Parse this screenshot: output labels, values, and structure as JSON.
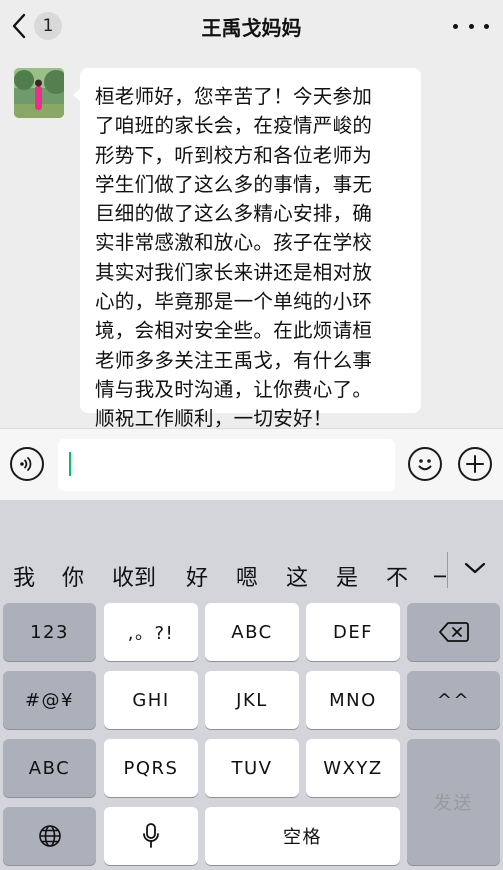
{
  "header": {
    "back_badge": "1",
    "title": "王禹戈妈妈"
  },
  "chat": {
    "message_lines": [
      "桓老师好，您辛苦了！今天参加",
      "了咱班的家长会，在疫情严峻的",
      "形势下，听到校方和各位老师为",
      "学生们做了这么多的事情，事无",
      "巨细的做了这么多精心安排，确",
      "实非常感激和放心。孩子在学校",
      "其实对我们家长来讲还是相对放",
      "心的，毕竟那是一个单纯的小环",
      "境，会相对安全些。在此烦请桓",
      "老师多多关注王禹戈，有什么事",
      "情与我及时沟通，让你费心了。",
      "顺祝工作顺利，一切安好！"
    ]
  },
  "input": {
    "value": ""
  },
  "keyboard": {
    "suggestions": [
      "我",
      "你",
      "收到",
      "好",
      "嗯",
      "这",
      "是",
      "不",
      "一"
    ],
    "keys": {
      "num": "123",
      "punct": ",。?!",
      "abc": "ABC",
      "def": "DEF",
      "symbols": "#@¥",
      "ghi": "GHI",
      "jkl": "JKL",
      "mno": "MNO",
      "emoticon": "^^",
      "abc_switch": "ABC",
      "pqrs": "PQRS",
      "tuv": "TUV",
      "wxyz": "WXYZ",
      "send": "发送",
      "space": "空格"
    }
  },
  "colors": {
    "cursor": "#07c160",
    "chat_bg": "#ededed",
    "keyboard_bg": "#d4d5da",
    "dark_key": "#acb0bb"
  }
}
